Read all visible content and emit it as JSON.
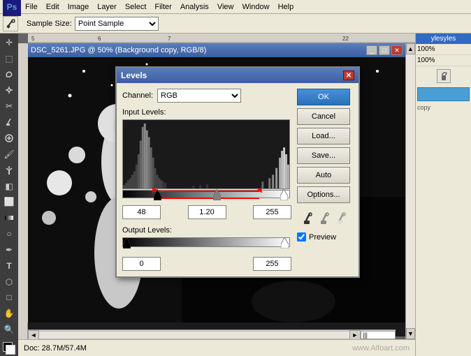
{
  "menubar": {
    "items": [
      "File",
      "Edit",
      "Image",
      "Layer",
      "Select",
      "Filter",
      "Analysis",
      "View",
      "Window",
      "Help"
    ]
  },
  "toolbar": {
    "sample_size_label": "Sample Size:",
    "sample_size_value": "Point Sample"
  },
  "canvas": {
    "title": "DSC_5261.JPG @ 50% (Background copy, RGB/8)"
  },
  "right_panel": {
    "styles_label": "yles",
    "zoom1": "100%",
    "zoom2": "100%"
  },
  "status_bar": {
    "doc_size": "Doc: 28.7M/57.4M"
  },
  "dialog": {
    "title": "Levels",
    "channel_label": "Channel:",
    "channel_value": "RGB",
    "input_levels_label": "Input Levels:",
    "input_black": "48",
    "input_mid": "1.20",
    "input_white": "255",
    "output_levels_label": "Output Levels:",
    "output_black": "0",
    "output_white": "255",
    "ok_label": "OK",
    "cancel_label": "Cancel",
    "load_label": "Load...",
    "save_label": "Save...",
    "auto_label": "Auto",
    "options_label": "Options...",
    "preview_label": "Preview",
    "preview_checked": true
  },
  "watermark": "www.Alfoart.com"
}
